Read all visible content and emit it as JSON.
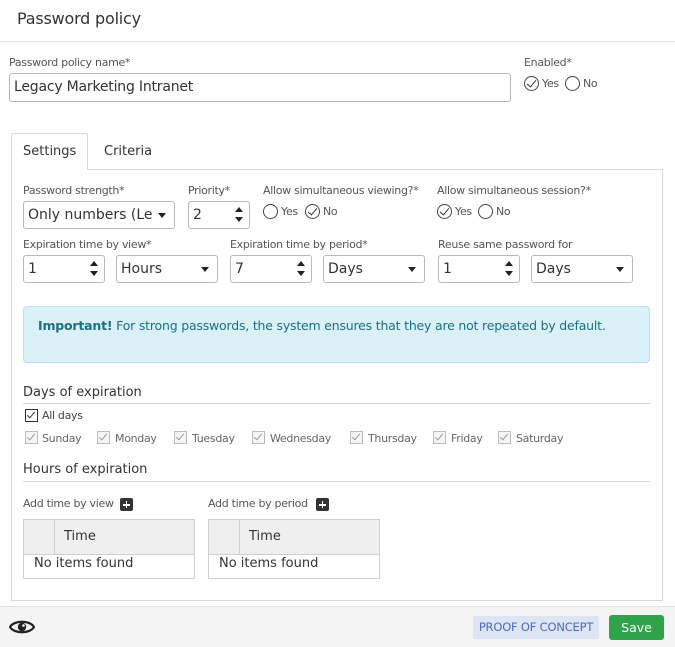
{
  "header": {
    "title": "Password policy"
  },
  "form": {
    "name_label": "Password policy name*",
    "name_value": "Legacy Marketing Intranet",
    "enabled_label": "Enabled*",
    "enabled_yes": "Yes",
    "enabled_no": "No",
    "enabled_value": "Yes"
  },
  "tabs": [
    {
      "label": "Settings",
      "active": true
    },
    {
      "label": "Criteria",
      "active": false
    }
  ],
  "settings": {
    "strength_label": "Password strength*",
    "strength_value": "Only numbers (Le",
    "priority_label": "Priority*",
    "priority_value": "2",
    "sim_view_label": "Allow simultaneous viewing?*",
    "sim_view_yes": "Yes",
    "sim_view_no": "No",
    "sim_view_value": "No",
    "sim_session_label": "Allow simultaneous session?*",
    "sim_session_yes": "Yes",
    "sim_session_no": "No",
    "sim_session_value": "Yes",
    "exp_view_label": "Expiration time by view*",
    "exp_view_value": "1",
    "exp_view_unit": "Hours",
    "exp_period_label": "Expiration time by period*",
    "exp_period_value": "7",
    "exp_period_unit": "Days",
    "reuse_label": "Reuse same password for",
    "reuse_value": "1",
    "reuse_unit": "Days"
  },
  "alert": {
    "strong": "Important!",
    "text": "For strong passwords, the system ensures that they are not repeated by default."
  },
  "days": {
    "title": "Days of expiration",
    "all_label": "All days",
    "items": [
      "Sunday",
      "Monday",
      "Tuesday",
      "Wednesday",
      "Thursday",
      "Friday",
      "Saturday"
    ]
  },
  "hours": {
    "title": "Hours of expiration",
    "by_view_label": "Add time by view",
    "by_period_label": "Add time by period",
    "col_time": "Time",
    "empty": "No items found"
  },
  "footer": {
    "poc_label": "PROOF OF CONCEPT",
    "save_label": "Save"
  },
  "colors": {
    "accent_green": "#2ea34a",
    "alert_bg": "#d9f1f6",
    "alert_text": "#1d6f84",
    "poc_bg": "#dde4f4",
    "poc_text": "#4b6cc0"
  },
  "icons": {
    "footer_left": "eye-icon",
    "add": "plus-square-icon"
  }
}
